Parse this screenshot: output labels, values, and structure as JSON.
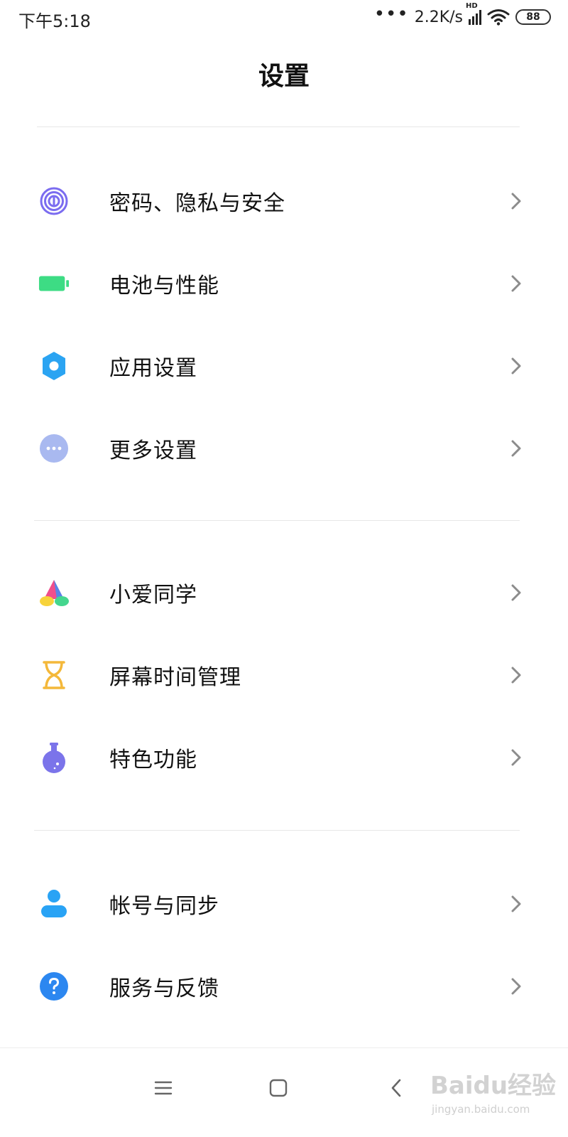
{
  "status_bar": {
    "time": "下午5:18",
    "dots": "•••",
    "net_speed": "2.2K/s",
    "signal_badge": "HD",
    "battery": "88"
  },
  "page": {
    "title": "设置"
  },
  "groups": [
    {
      "items": [
        {
          "label": "密码、隐私与安全",
          "icon": "fingerprint-icon"
        },
        {
          "label": "电池与性能",
          "icon": "battery-icon"
        },
        {
          "label": "应用设置",
          "icon": "gear-icon"
        },
        {
          "label": "更多设置",
          "icon": "more-dots-icon"
        }
      ]
    },
    {
      "items": [
        {
          "label": "小爱同学",
          "icon": "xiaoai-icon"
        },
        {
          "label": "屏幕时间管理",
          "icon": "hourglass-icon"
        },
        {
          "label": "特色功能",
          "icon": "flask-icon"
        }
      ]
    },
    {
      "items": [
        {
          "label": "帐号与同步",
          "icon": "user-icon"
        },
        {
          "label": "服务与反馈",
          "icon": "help-icon"
        }
      ]
    }
  ],
  "watermark": {
    "logo": "Baidu经验",
    "url": "jingyan.baidu.com"
  },
  "colors": {
    "fingerprint": "#7b6cf0",
    "battery": "#3ddc84",
    "gear": "#2ba4f2",
    "more": "#a9b9f0",
    "hourglass": "#f4b83a",
    "flask": "#7b74ea",
    "user": "#29a3f5",
    "help": "#2c87f0",
    "chevron": "#8c8c8c"
  }
}
